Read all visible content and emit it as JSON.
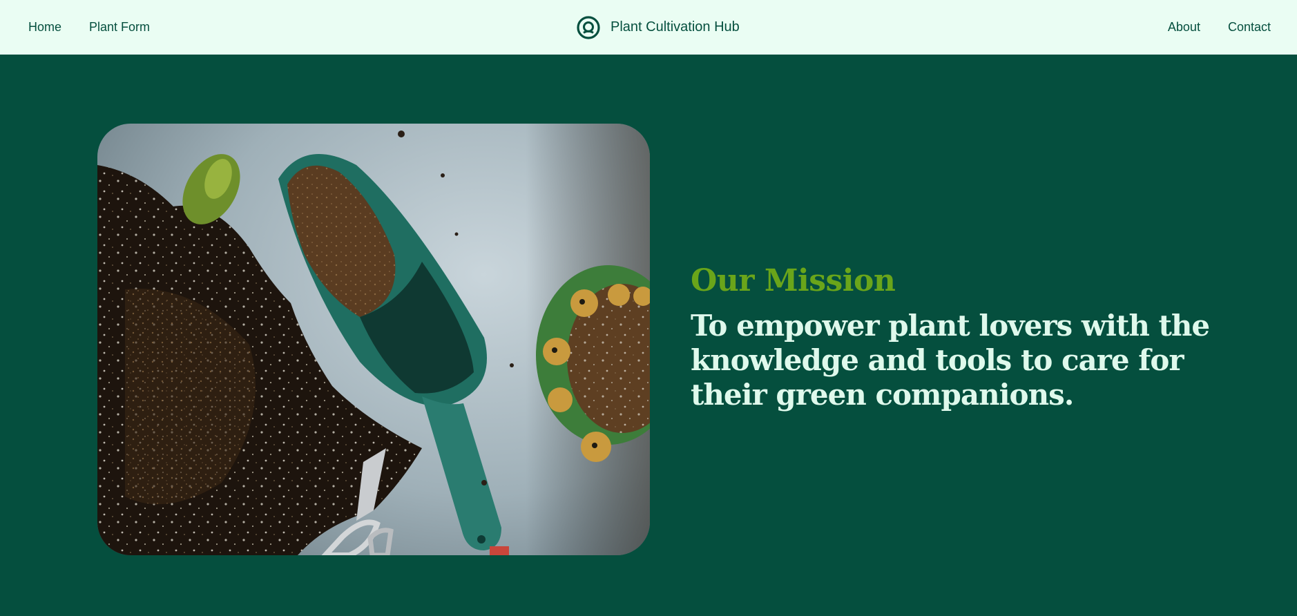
{
  "nav": {
    "left_links": [
      "Home",
      "Plant Form"
    ],
    "right_links": [
      "About",
      "Contact"
    ],
    "brand_name": "Plant Cultivation Hub",
    "brand_icon": "leaf-circle-logo-icon"
  },
  "hero": {
    "image_subject": "garden-trowel-and-soil-photo",
    "eyebrow": "Our Mission",
    "statement": "To empower plant lovers with the knowledge and tools to care for their green companions."
  },
  "colors": {
    "nav_background": "#eafdf3",
    "page_background": "#054f3e",
    "accent_green": "#6aa51a",
    "statement_text": "#dff9ec"
  }
}
